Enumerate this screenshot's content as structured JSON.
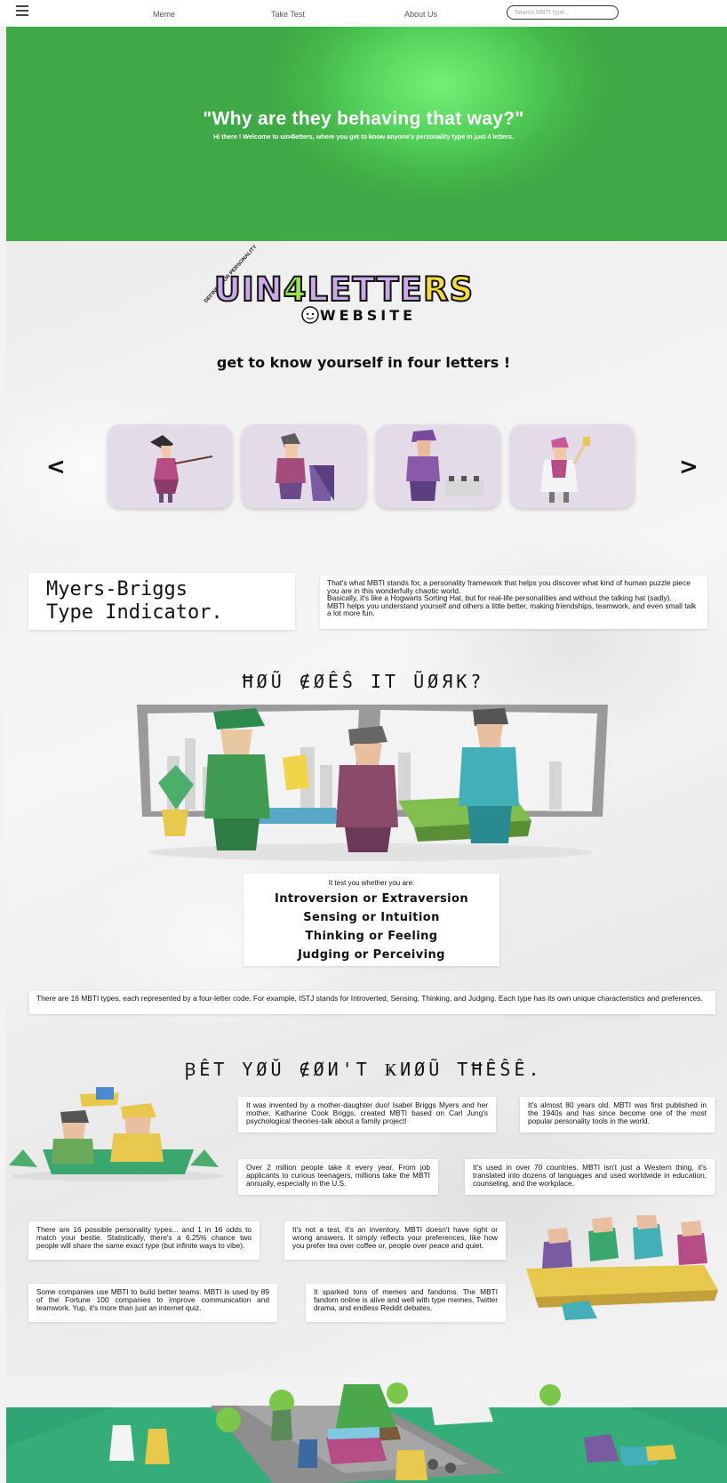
{
  "nav": {
    "links": [
      "Meme",
      "Take Test",
      "About Us"
    ],
    "search_placeholder": "Search MBTI type..."
  },
  "hero": {
    "title": "\"Why are they behaving that way?\"",
    "subtitle": "Hi there ! Welcome to uin4letters, where you get to know anyone's personality type in just 4 letters."
  },
  "logo": {
    "curve_text": "DEFINE YOUR PERSONALITY",
    "part1": "UIN",
    "part2": "4",
    "part3": "LETTE",
    "part4": "RS",
    "sub": "WEBSITE"
  },
  "tagline": "get to know yourself in four letters !",
  "carousel": {
    "prev_icon": "<",
    "next_icon": ">"
  },
  "mbti": {
    "title": "Myers-Briggs\nType Indicator.",
    "paragraphs": [
      "That's what MBTI stands for, a personality framework that helps you discover what kind of human puzzle piece you are in this wonderfully chaotic world.",
      "Basically, it's like a Hogwarts Sorting Hat, but for real-life personalities and without the talking hat (sadly).",
      "MBTI helps you understand yourself and others a little better, making friendships, teamwork, and even small talk a lot more fun."
    ]
  },
  "how": {
    "heading": "ĦØŨ ∉ØÊŜ IT ŨØЯK?",
    "intro": "It test you whether you are:",
    "dimensions": [
      "Introversion or Extraversion",
      "Sensing or Intuition",
      "Thinking or Feeling",
      "Judging or Perceiving"
    ],
    "types_note": "There are 16 MBTI types, each represented by a four-letter code. For example, ISTJ stands for Introverted, Sensing, Thinking, and Judging. Each type has its own unique characteristics and preferences."
  },
  "facts": {
    "heading": "ꞴÊT YØŬ ∉ØИ'T ҜИØŨ TĦÊŜÊ.",
    "items": [
      "It was invented by a mother-daughter duo! Isabel Briggs Myers and her mother, Katharine Cook Briggs, created MBTI based on Carl Jung's psychological theories-talk about a family project!",
      "It's almost 80 years old. MBTI was first published in the 1940s and has since become one of the most popular personality tools in the world.",
      "Over 2 million people take it every year. From job applicants to curious teenagers, millions take the MBTI annually, especially in the U.S.",
      "It's used in over 70 countries. MBTI isn't just a Western thing, it's translated into dozens of languages and used worldwide in education, counseling, and the workplace.",
      "There are 16 possible personality types... and 1 in 16 odds to match your bestie. Statistically, there's a 6.25% chance two people will share the same exact type (but infinite ways to vibe).",
      "It's not a test, it's an inventory. MBTI doesn't have right or wrong answers. It simply reflects your preferences, like how you prefer tea over coffee or, people over peace and quiet.",
      "Some companies use MBTI to build better teams. MBTI is used by 89 of the Fortune 100 companies to improve communication and teamwork. Yup, it's more than just an internet quiz.",
      "It sparked tons of memes and fandoms. The MBTI fandom online is alive and well with type memes, Twitter drama, and endless Reddit debates."
    ]
  },
  "colors": {
    "hero_green": "#55d35b",
    "card_lilac": "#e4dbe9",
    "footer_green": "#2fa472"
  }
}
